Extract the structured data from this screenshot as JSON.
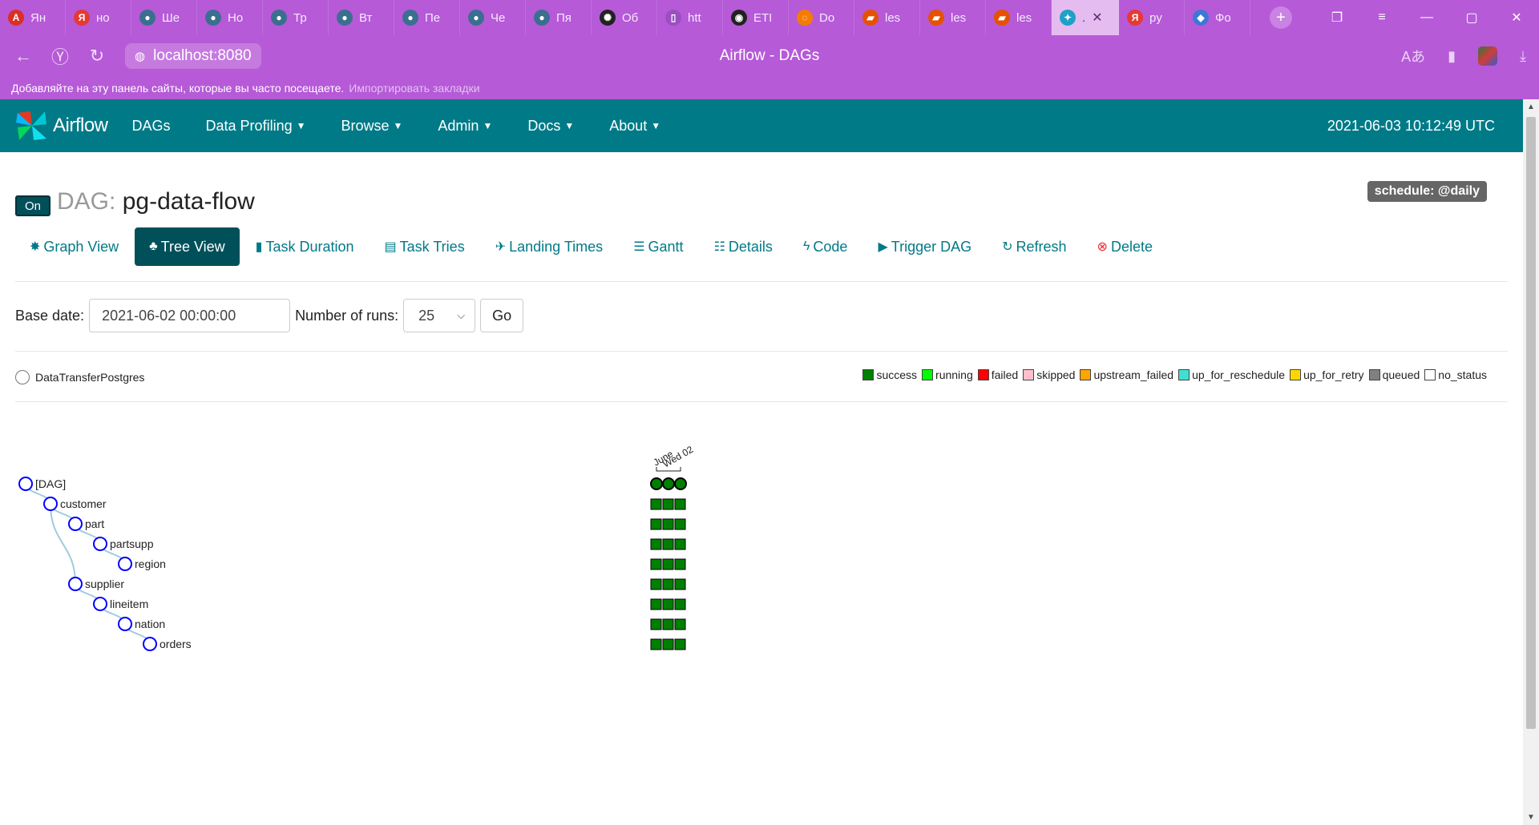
{
  "browser": {
    "tabs": [
      {
        "label": "Ян",
        "color": "#d93025",
        "glyph": "А"
      },
      {
        "label": "но",
        "color": "#e53935",
        "glyph": "Я"
      },
      {
        "label": "Ше",
        "color": "#3b6f8f",
        "glyph": "●"
      },
      {
        "label": "Но",
        "color": "#3b6f8f",
        "glyph": "●"
      },
      {
        "label": "Тр",
        "color": "#3b6f8f",
        "glyph": "●"
      },
      {
        "label": "Вт",
        "color": "#3b6f8f",
        "glyph": "●"
      },
      {
        "label": "Пе",
        "color": "#3b6f8f",
        "glyph": "●"
      },
      {
        "label": "Че",
        "color": "#3b6f8f",
        "glyph": "●"
      },
      {
        "label": "Пя",
        "color": "#3b6f8f",
        "glyph": "●"
      },
      {
        "label": "Об",
        "color": "#222222",
        "glyph": "✺"
      },
      {
        "label": "htt",
        "color": "#9a4fc0",
        "glyph": "▯"
      },
      {
        "label": "ETI",
        "color": "#222222",
        "glyph": "◉"
      },
      {
        "label": "Do",
        "color": "#f57c00",
        "glyph": "◌"
      },
      {
        "label": "les",
        "color": "#e65100",
        "glyph": "▰"
      },
      {
        "label": "les",
        "color": "#e65100",
        "glyph": "▰"
      },
      {
        "label": "les",
        "color": "#e65100",
        "glyph": "▰"
      },
      {
        "label": ".",
        "color": "#1ea1c6",
        "glyph": "✦",
        "active": true
      },
      {
        "label": "py",
        "color": "#e53935",
        "glyph": "Я"
      },
      {
        "label": "Фо",
        "color": "#3c78d8",
        "glyph": "◆"
      }
    ],
    "url": "localhost:8080",
    "page_title": "Airflow - DAGs",
    "bookmarks_text": "Добавляйте на эту панель сайты, которые вы часто посещаете.",
    "bookmarks_import": "Импортировать закладки"
  },
  "navbar": {
    "brand": "Airflow",
    "items": [
      {
        "label": "DAGs",
        "dropdown": false
      },
      {
        "label": "Data Profiling",
        "dropdown": true
      },
      {
        "label": "Browse",
        "dropdown": true
      },
      {
        "label": "Admin",
        "dropdown": true
      },
      {
        "label": "Docs",
        "dropdown": true
      },
      {
        "label": "About",
        "dropdown": true
      }
    ],
    "time": "2021-06-03 10:12:49 UTC"
  },
  "dag": {
    "toggle": "On",
    "title_prefix": "DAG:",
    "title": "pg-data-flow",
    "schedule": "schedule: @daily"
  },
  "views": [
    {
      "label": "Graph View",
      "icon": "✸",
      "name": "graph-view"
    },
    {
      "label": "Tree View",
      "icon": "♣",
      "name": "tree-view",
      "active": true
    },
    {
      "label": "Task Duration",
      "icon": "▮",
      "name": "task-duration"
    },
    {
      "label": "Task Tries",
      "icon": "▤",
      "name": "task-tries"
    },
    {
      "label": "Landing Times",
      "icon": "✈",
      "name": "landing-times"
    },
    {
      "label": "Gantt",
      "icon": "☰",
      "name": "gantt"
    },
    {
      "label": "Details",
      "icon": "☷",
      "name": "details"
    },
    {
      "label": "Code",
      "icon": "ϟ",
      "name": "code"
    },
    {
      "label": "Trigger DAG",
      "icon": "▶",
      "name": "trigger-dag"
    },
    {
      "label": "Refresh",
      "icon": "↻",
      "name": "refresh"
    },
    {
      "label": "Delete",
      "icon": "⊗",
      "name": "delete"
    }
  ],
  "form": {
    "base_date_label": "Base date:",
    "base_date_value": "2021-06-02 00:00:00",
    "runs_label": "Number of runs:",
    "runs_value": "25",
    "go_label": "Go"
  },
  "dag_radio_label": "DataTransferPostgres",
  "legend": [
    {
      "label": "success",
      "color": "#008000"
    },
    {
      "label": "running",
      "color": "#00ff00"
    },
    {
      "label": "failed",
      "color": "#ff0000"
    },
    {
      "label": "skipped",
      "color": "#ffc0cb"
    },
    {
      "label": "upstream_failed",
      "color": "#ffa500"
    },
    {
      "label": "up_for_reschedule",
      "color": "#40e0d0"
    },
    {
      "label": "up_for_retry",
      "color": "#ffd700"
    },
    {
      "label": "queued",
      "color": "#808080"
    },
    {
      "label": "no_status",
      "color": "#ffffff"
    }
  ],
  "tree": {
    "date_label_1": "June",
    "date_label_2": "Wed 02",
    "runs": 3,
    "status_color": "#008000",
    "nodes": [
      {
        "label": "[DAG]",
        "depth": 0
      },
      {
        "label": "customer",
        "depth": 1
      },
      {
        "label": "part",
        "depth": 2
      },
      {
        "label": "partsupp",
        "depth": 3
      },
      {
        "label": "region",
        "depth": 4
      },
      {
        "label": "supplier",
        "depth": 2
      },
      {
        "label": "lineitem",
        "depth": 3
      },
      {
        "label": "nation",
        "depth": 4
      },
      {
        "label": "orders",
        "depth": 5
      }
    ]
  }
}
